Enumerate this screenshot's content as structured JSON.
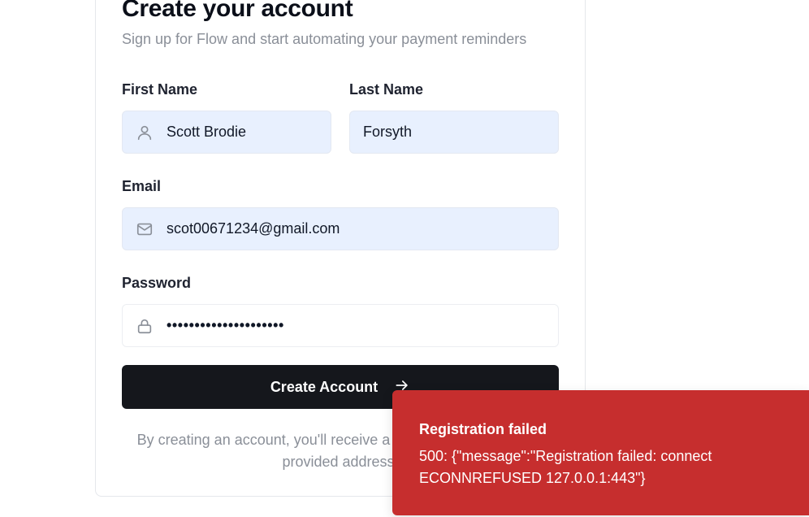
{
  "header": {
    "title": "Create your account",
    "subtitle": "Sign up for Flow and start automating your payment reminders"
  },
  "form": {
    "first_name": {
      "label": "First Name",
      "value": "Scott Brodie",
      "icon": "user-icon"
    },
    "last_name": {
      "label": "Last Name",
      "value": "Forsyth"
    },
    "email": {
      "label": "Email",
      "value": "scot00671234@gmail.com",
      "icon": "mail-icon"
    },
    "password": {
      "label": "Password",
      "value": "•••••••••••••••••••••",
      "icon": "lock-icon"
    },
    "submit_label": "Create Account",
    "submit_icon": "arrow-right-icon",
    "terms_text": "By creating an account, you'll receive a verification email at the provided address."
  },
  "toast": {
    "title": "Registration failed",
    "message": "500: {\"message\":\"Registration failed: connect ECONNREFUSED 127.0.0.1:443\"}",
    "color": "#c62e2e"
  },
  "colors": {
    "button_bg": "#15171c",
    "autofill_bg": "#e8f0fe"
  }
}
